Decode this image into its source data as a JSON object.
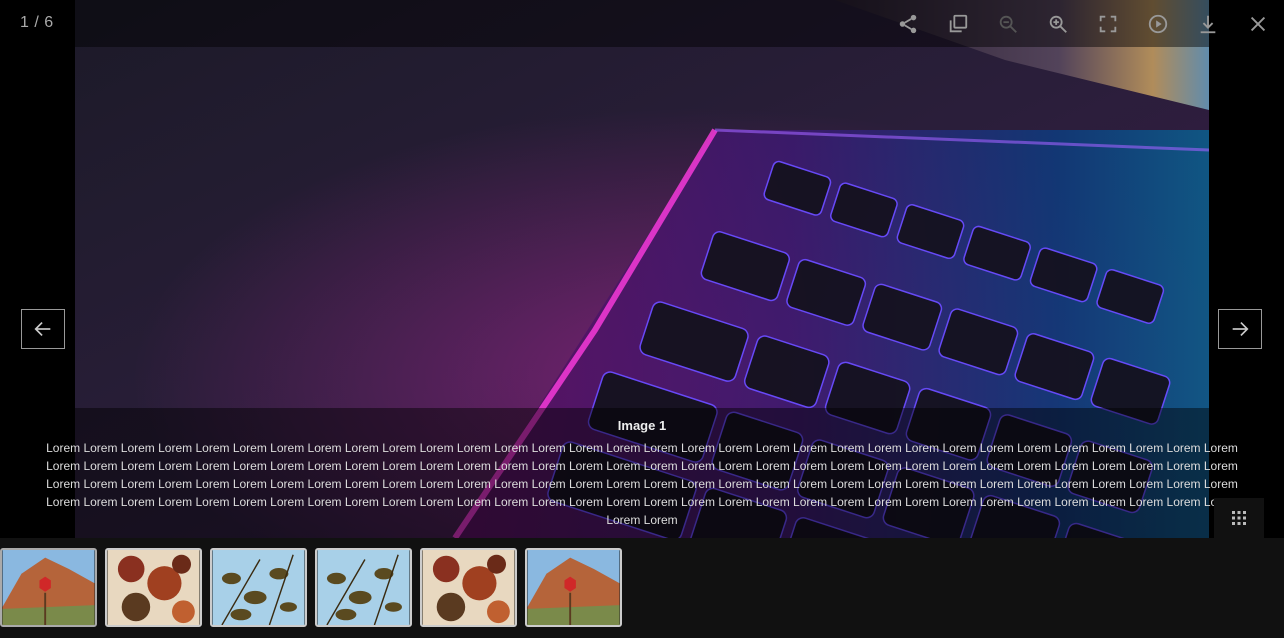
{
  "counter": {
    "current": "1",
    "separator": " / ",
    "total": "6"
  },
  "toolbar": {
    "buttons": [
      {
        "name": "share",
        "icon": "share-icon"
      },
      {
        "name": "copy",
        "icon": "copy-icon"
      },
      {
        "name": "zoom-out",
        "icon": "zoom-out-icon",
        "disabled": true
      },
      {
        "name": "zoom-in",
        "icon": "zoom-in-icon"
      },
      {
        "name": "fullscreen",
        "icon": "fullscreen-icon"
      },
      {
        "name": "autoplay",
        "icon": "play-icon"
      },
      {
        "name": "download",
        "icon": "download-icon"
      },
      {
        "name": "close",
        "icon": "close-icon"
      }
    ]
  },
  "navigation": {
    "prev_icon": "arrow-left-icon",
    "next_icon": "arrow-right-icon"
  },
  "caption": {
    "title": "Image 1",
    "text": "Lorem Lorem Lorem Lorem Lorem Lorem Lorem Lorem Lorem Lorem Lorem Lorem Lorem Lorem Lorem Lorem Lorem Lorem Lorem Lorem Lorem Lorem Lorem Lorem Lorem Lorem Lorem Lorem Lorem Lorem Lorem Lorem Lorem Lorem Lorem Lorem Lorem Lorem Lorem Lorem Lorem Lorem Lorem Lorem Lorem Lorem Lorem Lorem Lorem Lorem Lorem Lorem Lorem Lorem Lorem Lorem Lorem Lorem Lorem Lorem Lorem Lorem Lorem Lorem Lorem Lorem Lorem Lorem Lorem Lorem Lorem Lorem Lorem Lorem Lorem Lorem Lorem Lorem Lorem Lorem Lorem Lorem Lorem Lorem Lorem Lorem Lorem Lorem Lorem Lorem Lorem Lorem Lorem Lorem Lorem Lorem Lorem Lorem Lorem Lorem Lorem Lorem Lorem Lorem Lorem Lorem Lorem Lorem Lorem Lorem Lorem Lorem Lorem Lorem Lorem Lorem Lorem Lorem Lorem Lorem Lorem Lorem Lorem Lorem Lorem Lorem Lorem Lorem Lorem Lorem"
  },
  "thumbnails": [
    {
      "name": "thumb-1",
      "scene": "canyon-stop-sign",
      "active": true
    },
    {
      "name": "thumb-2",
      "scene": "autumn-leaves"
    },
    {
      "name": "thumb-3",
      "scene": "leaves-sky"
    },
    {
      "name": "thumb-4",
      "scene": "leaves-sky"
    },
    {
      "name": "thumb-5",
      "scene": "autumn-leaves"
    },
    {
      "name": "thumb-6",
      "scene": "canyon-stop-sign"
    }
  ],
  "grid_toggle": {
    "icon": "grid-icon"
  },
  "colors": {
    "background": "#000000",
    "thumb_bar": "#111111",
    "icon": "#999999",
    "keyboard_glow_pink": "#ff2bd6",
    "keyboard_glow_blue": "#2a8cff"
  }
}
